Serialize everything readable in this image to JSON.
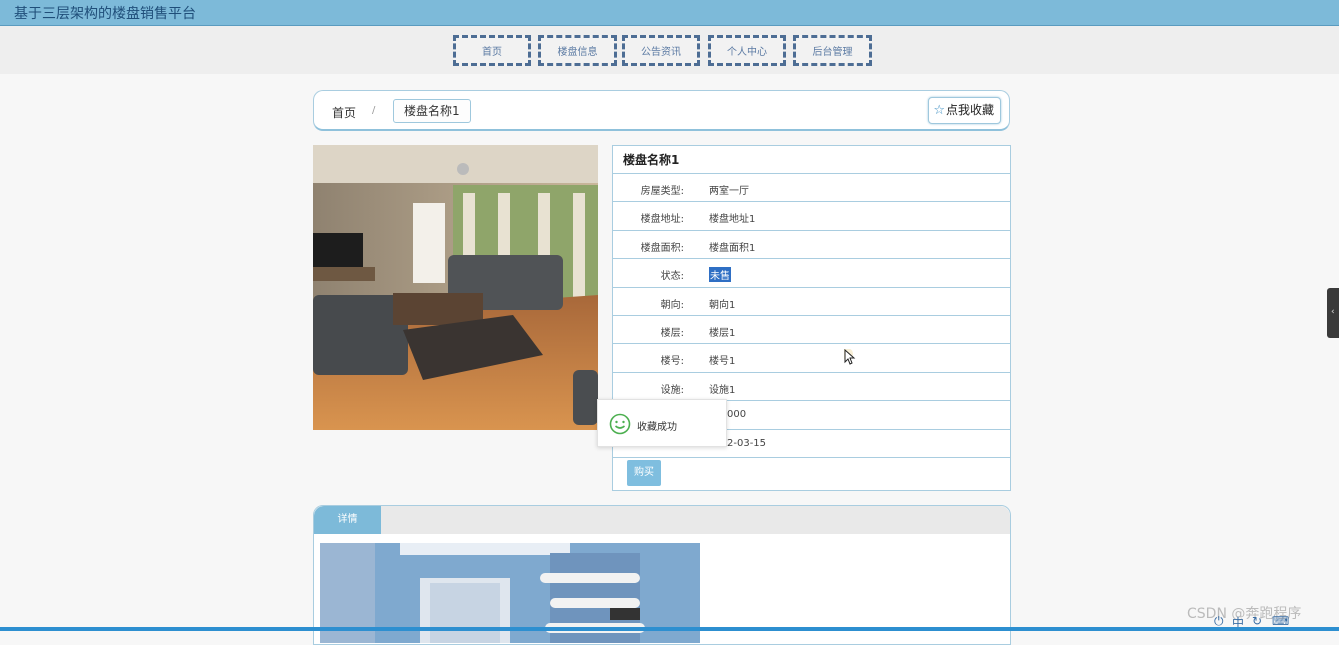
{
  "header": {
    "title": "基于三层架构的楼盘销售平台"
  },
  "nav": {
    "items": [
      "首页",
      "楼盘信息",
      "公告资讯",
      "个人中心",
      "后台管理"
    ]
  },
  "breadcrumb": {
    "home": "首页",
    "separator": "/",
    "current": "楼盘名称1"
  },
  "favorite": {
    "label": "点我收藏",
    "icon": "star-icon"
  },
  "property": {
    "name": "楼盘名称1",
    "fields": [
      {
        "label": "房屋类型:",
        "value": "两室一厅"
      },
      {
        "label": "楼盘地址:",
        "value": "楼盘地址1"
      },
      {
        "label": "楼盘面积:",
        "value": "楼盘面积1"
      },
      {
        "label": "状态:",
        "value": "未售"
      },
      {
        "label": "朝向:",
        "value": "朝向1"
      },
      {
        "label": "楼层:",
        "value": "楼层1"
      },
      {
        "label": "楼号:",
        "value": "楼号1"
      },
      {
        "label": "设施:",
        "value": "设施1"
      },
      {
        "label": "",
        "value": "000"
      },
      {
        "label": "",
        "value": "2-03-15"
      }
    ],
    "buy_label": "购买"
  },
  "toast": {
    "message": "收藏成功",
    "icon": "smile-icon"
  },
  "detail": {
    "tab_label": "详情"
  },
  "watermark": "CSDN @奔跑程序",
  "colors": {
    "header": "#7dbad9",
    "nav_border": "#4d6d94",
    "accent": "#7fbedf",
    "highlight": "#2f6fc4"
  }
}
